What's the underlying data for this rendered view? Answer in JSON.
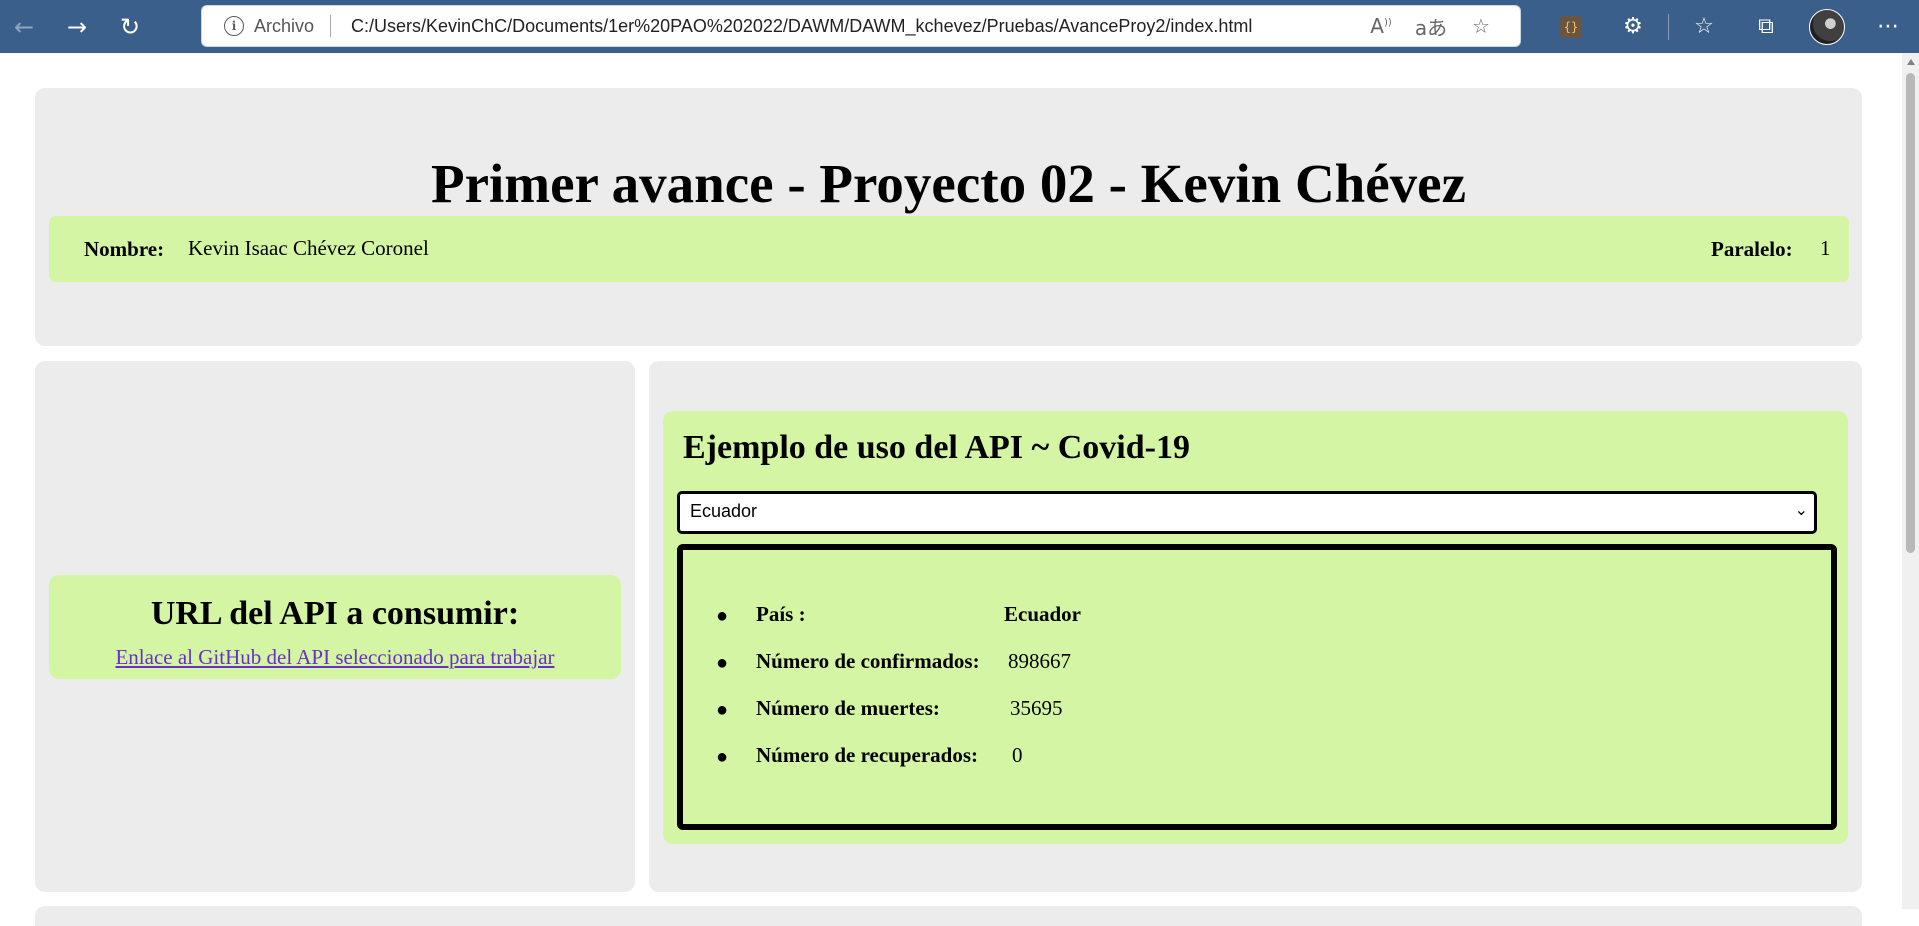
{
  "browser": {
    "security_label": "Archivo",
    "url": "C:/Users/KevinChC/Documents/1er%20PAO%202022/DAWM/DAWM_kchevez/Pruebas/AvanceProy2/index.html",
    "icons": {
      "back": "back-arrow-icon",
      "forward": "forward-arrow-icon",
      "refresh": "refresh-icon",
      "info": "info-icon",
      "read_aloud": "read-aloud-icon",
      "translate": "translate-icon",
      "add_favorite": "add-favorite-icon",
      "extension_json": "json-extension-icon",
      "extensions": "extensions-icon",
      "favorites": "favorites-icon",
      "collections": "collections-icon",
      "profile": "profile-avatar",
      "more": "more-options-icon"
    }
  },
  "header": {
    "title": "Primer avance - Proyecto 02 - Kevin Chévez",
    "nombre_label": "Nombre:",
    "nombre_value": "Kevin Isaac Chévez Coronel",
    "paralelo_label": "Paralelo:",
    "paralelo_value": "1"
  },
  "api_section": {
    "title": "URL del API a consumir:",
    "link_text": "Enlace al GitHub del API seleccionado para trabajar"
  },
  "covid": {
    "title": "Ejemplo de uso del API ~ Covid-19",
    "selected_country": "Ecuador",
    "stats": [
      {
        "label": "País :",
        "value": "Ecuador",
        "bold": true
      },
      {
        "label": "Número de confirmados:",
        "value": "898667",
        "bold": false
      },
      {
        "label": "Número de muertes:",
        "value": "35695",
        "bold": false
      },
      {
        "label": "Número de recuperados:",
        "value": "0",
        "bold": false
      }
    ]
  },
  "colors": {
    "chrome_bar": "#3a5f8a",
    "panel_bg": "#ececec",
    "accent_green": "#d4f5a3",
    "link": "#6a2fc8"
  }
}
